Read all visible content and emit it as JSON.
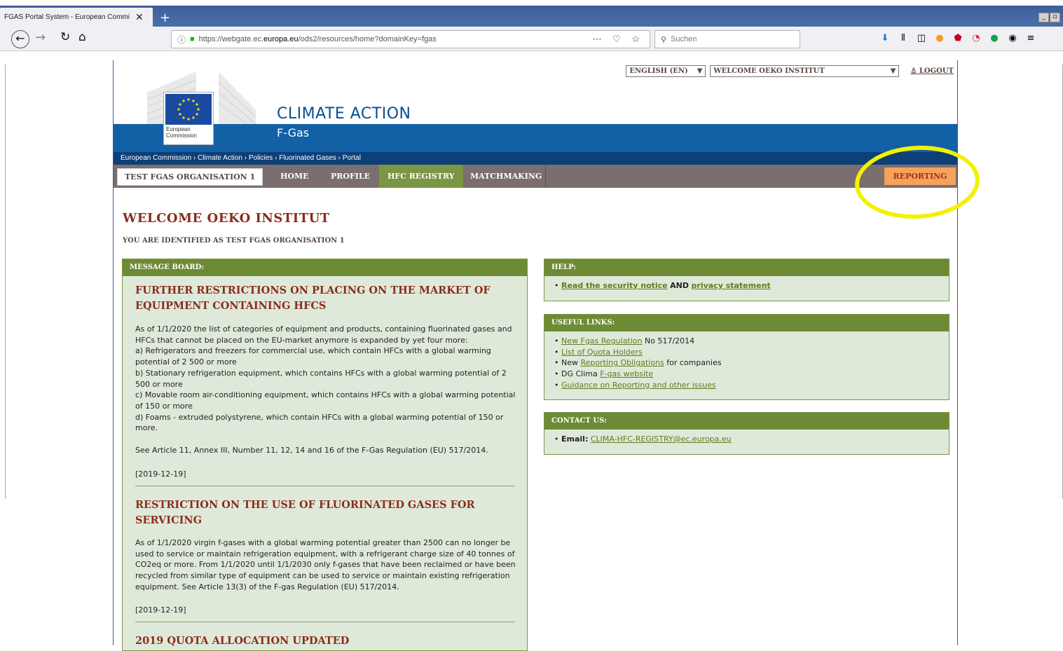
{
  "browser": {
    "tab_title": "FGAS Portal System - European Commi",
    "tab_close": "✕",
    "new_tab": "+",
    "url_prefix": "https://webgate.ec.",
    "url_domain": "europa.eu",
    "url_suffix": "/ods2/resources/home?domainKey=fgas",
    "url_actions": "⋯ ♡ ☆",
    "search_placeholder": "Suchen"
  },
  "header": {
    "language": "ENGLISH (EN)",
    "welcome_select": "WELCOME OEKO INSTITUT",
    "logout": "LOGOUT",
    "eu_text_1": "European",
    "eu_text_2": "Commission",
    "site_title": "CLIMATE ACTION",
    "site_subtitle": "F-Gas",
    "breadcrumb": "European Commission › Climate Action › Policies › Fluorinated Gases › Portal"
  },
  "menu": {
    "organisation": "TEST FGAS ORGANISATION 1",
    "home": "HOME",
    "profile": "PROFILE",
    "hfc_registry": "HFC REGISTRY",
    "matchmaking": "MATCHMAKING",
    "reporting": "REPORTING"
  },
  "main": {
    "welcome": "WELCOME OEKO INSTITUT",
    "identified": "YOU ARE IDENTIFIED AS TEST FGAS ORGANISATION 1",
    "message_board": {
      "title": "MESSAGE BOARD:",
      "messages": [
        {
          "title": "FURTHER RESTRICTIONS ON PLACING ON THE MARKET OF EQUIPMENT CONTAINING HFCS",
          "body": "As of 1/1/2020 the list of categories of equipment and products, containing fluorinated gases and HFCs that cannot be placed on the EU-market anymore is expanded by yet four more:\na) Refrigerators and freezers for commercial use, which contain HFCs with a global warming potential of 2 500 or more\nb) Stationary refrigeration equipment, which contains HFCs with a global warming potential of 2 500 or more\nc) Movable room air-conditioning equipment, which contains HFCs with a global warming potential of 150 or more\nd) Foams - extruded polystyrene, which contain HFCs with a global warming potential of 150 or more.\n\nSee Article 11, Annex III, Number 11, 12, 14 and 16 of the F-Gas Regulation (EU) 517/2014.",
          "date": "[2019-12-19]"
        },
        {
          "title": "RESTRICTION ON THE USE OF FLUORINATED GASES FOR SERVICING",
          "body": "As of 1/1/2020 virgin f-gases with a global warming potential greater than 2500 can no longer be used to service or maintain refrigeration equipment, with a refrigerant charge size of 40 tonnes of CO2eq or more. From 1/1/2020 until 1/1/2030 only f-gases that have been reclaimed or have been recycled from similar type of equipment can be used to service or maintain existing refrigeration equipment. See Article 13(3) of the F-gas Regulation (EU) 517/2014.",
          "date": "[2019-12-19]"
        },
        {
          "title": "2019 QUOTA ALLOCATION UPDATED"
        }
      ]
    },
    "help": {
      "title": "HELP:",
      "link1": "Read the security notice",
      "and": "AND",
      "link2": "privacy statement"
    },
    "useful_links": {
      "title": "USEFUL LINKS:",
      "l1_link": "New Fgas Regulation",
      "l1_rest": "No 517/2014",
      "l2_link": "List of Quota Holders",
      "l3_pre": "New",
      "l3_link": "Reporting Obligations",
      "l3_rest": "for companies",
      "l4_pre": "DG Clima",
      "l4_link": "F-gas website",
      "l5_link": "Guidance on Reporting and other issues"
    },
    "contact": {
      "title": "CONTACT US:",
      "label": "Email:",
      "email": "CLIMA-HFC-REGISTRY@ec.europa.eu"
    }
  },
  "colors": {
    "menu_bg": "#7a6e6e",
    "accent_green": "#6d8a35",
    "reporting_orange": "#f5a25b",
    "title_red": "#8b2d1d",
    "highlight_yellow": "#f2f200"
  }
}
